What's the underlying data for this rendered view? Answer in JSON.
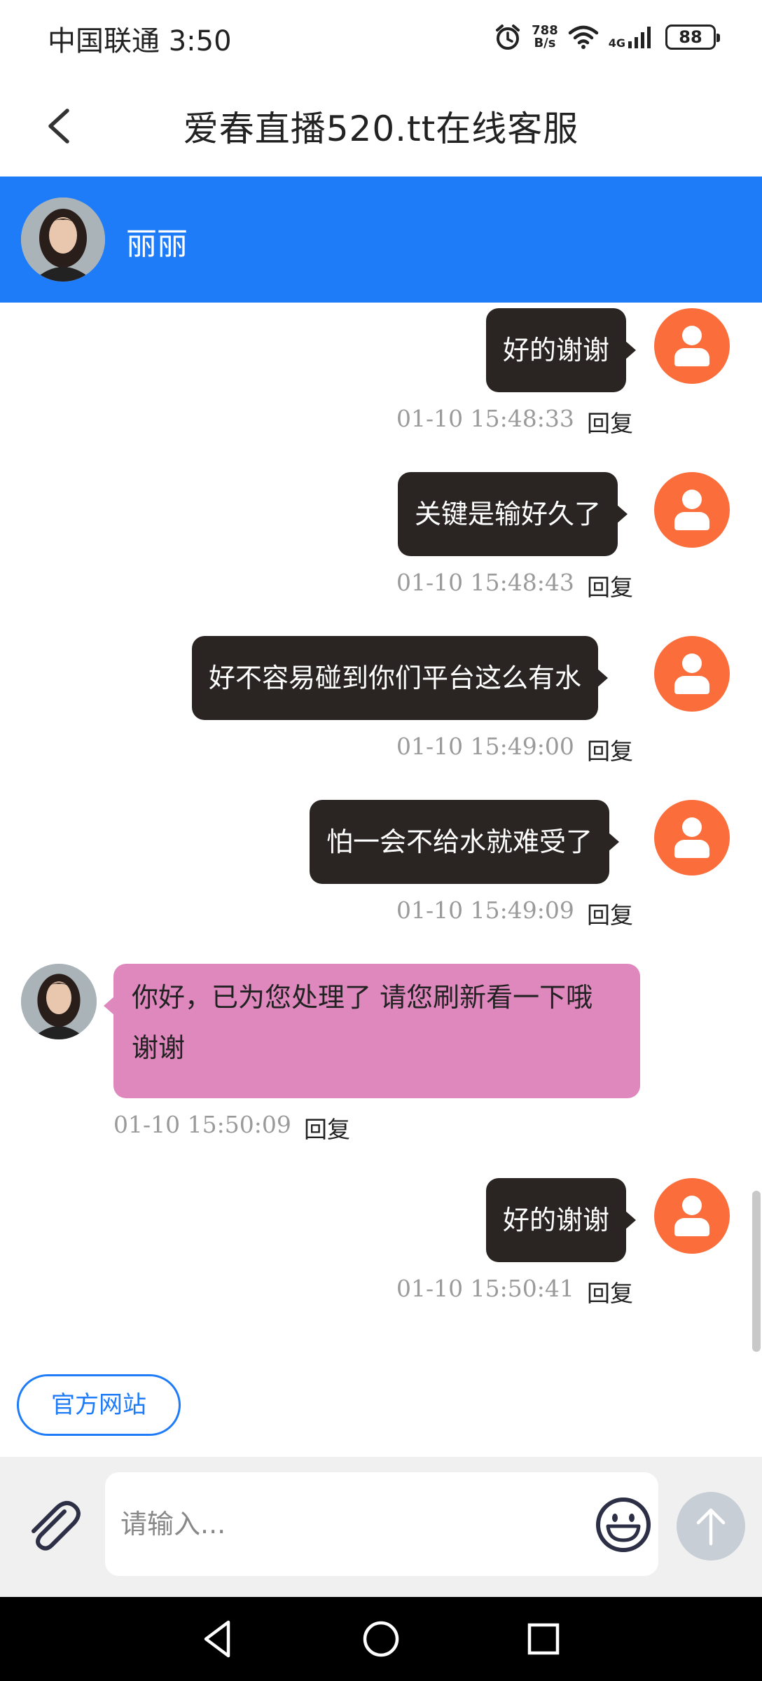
{
  "status": {
    "carrier_time": "中国联通 3:50",
    "net_speed_value": "788",
    "net_speed_unit": "B/s",
    "signal_label": "4G",
    "battery": "88"
  },
  "header": {
    "title": "爱春直播520.tt在线客服"
  },
  "agent": {
    "name": "丽丽"
  },
  "messages": [
    {
      "text": "好的谢谢",
      "time": "01-10 15:48:33",
      "reply": "回复"
    },
    {
      "text": "关键是输好久了",
      "time": "01-10 15:48:43",
      "reply": "回复"
    },
    {
      "text": "好不容易碰到你们平台这么有水",
      "time": "01-10 15:49:00",
      "reply": "回复"
    },
    {
      "text": "怕一会不给水就难受了",
      "time": "01-10 15:49:09",
      "reply": "回复"
    },
    {
      "text": "你好，已为您处理了  请您刷新看一下哦 谢谢",
      "time": "01-10 15:50:09",
      "reply": "回复"
    },
    {
      "text": "好的谢谢",
      "time": "01-10 15:50:41",
      "reply": "回复"
    }
  ],
  "site_button": "官方网站",
  "input": {
    "placeholder": "请输入..."
  },
  "colors": {
    "accent": "#1e7cf8",
    "outgoing_bubble": "#2a2523",
    "incoming_bubble": "#de88bd",
    "user_avatar": "#fb6d3a"
  }
}
